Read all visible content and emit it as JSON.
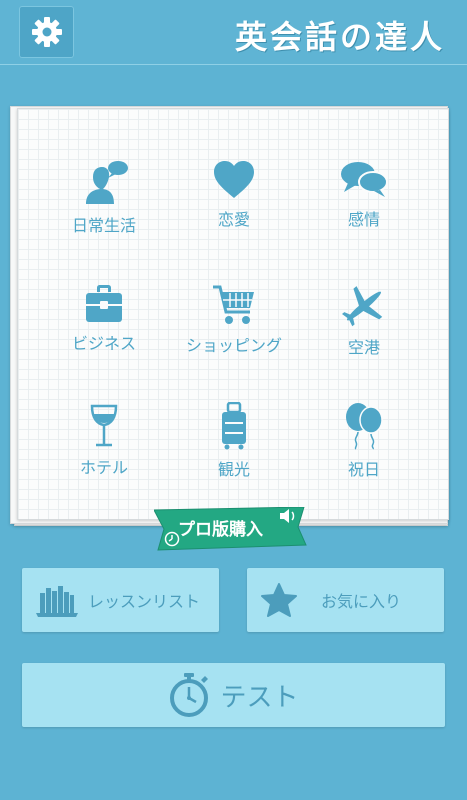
{
  "header": {
    "title": "英会話の達人",
    "settings_icon": "gear-icon"
  },
  "categories": [
    {
      "label": "日常生活",
      "icon": "person-speech-icon"
    },
    {
      "label": "恋愛",
      "icon": "heart-icon"
    },
    {
      "label": "感情",
      "icon": "chat-bubbles-icon"
    },
    {
      "label": "ビジネス",
      "icon": "briefcase-icon"
    },
    {
      "label": "ショッピング",
      "icon": "shopping-cart-icon"
    },
    {
      "label": "空港",
      "icon": "airplane-icon"
    },
    {
      "label": "ホテル",
      "icon": "wine-glass-icon"
    },
    {
      "label": "観光",
      "icon": "suitcase-icon"
    },
    {
      "label": "祝日",
      "icon": "balloons-icon"
    }
  ],
  "promo": {
    "label": "プロ版購入"
  },
  "buttons": {
    "lesson_list": "レッスンリスト",
    "favorites": "お気に入り",
    "test": "テスト"
  },
  "colors": {
    "background": "#5db3d3",
    "icon": "#4fa6c7",
    "button": "#a6e2f2",
    "ribbon": "#23a883"
  }
}
